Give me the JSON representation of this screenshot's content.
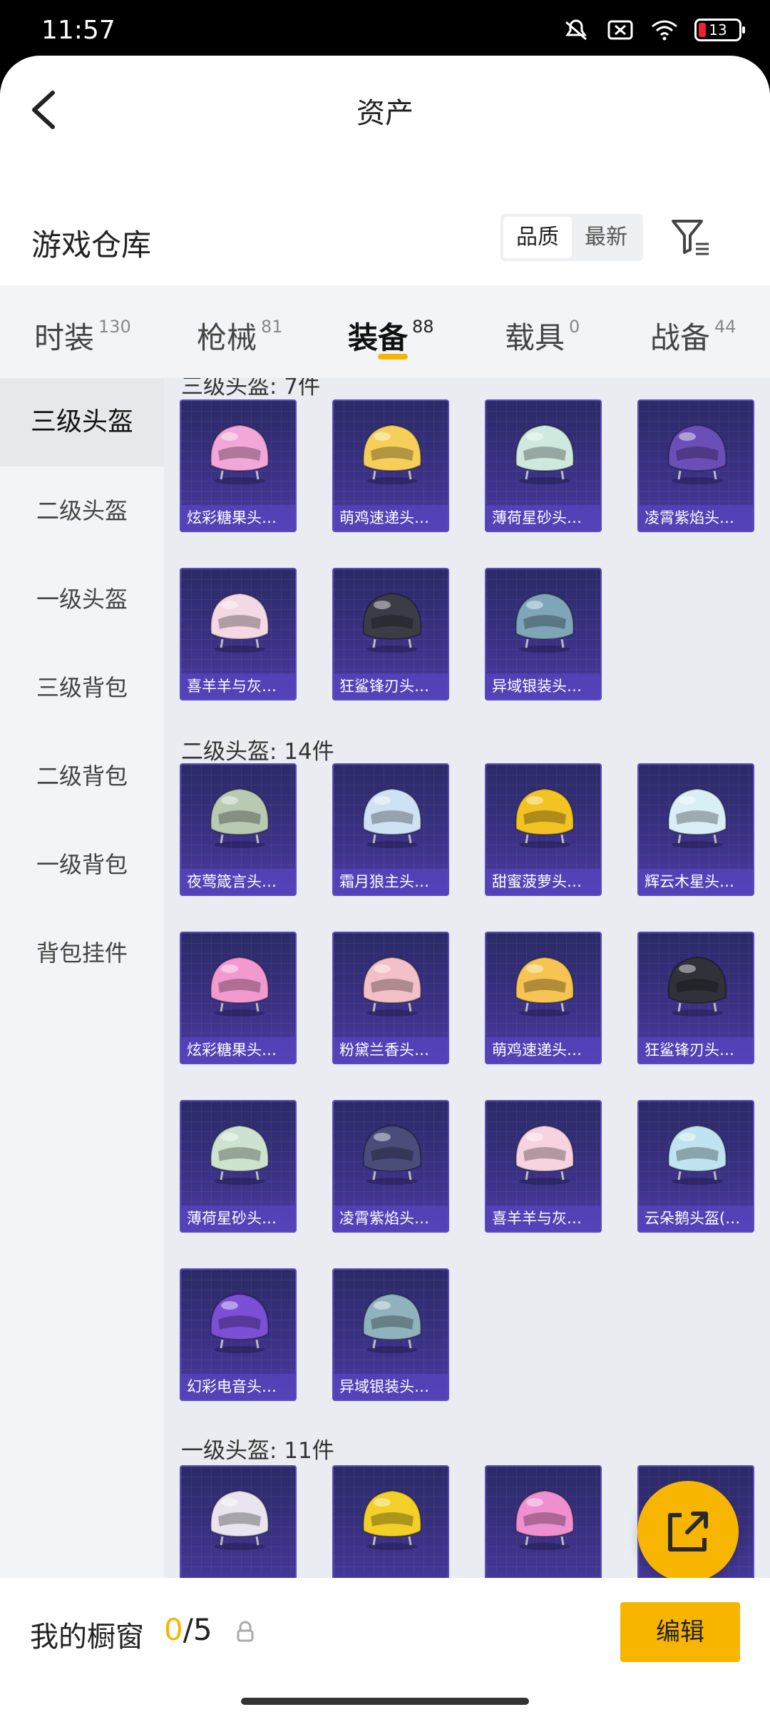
{
  "status_bar": {
    "time": "11:57",
    "battery": "13"
  },
  "header": {
    "title": "资产"
  },
  "warehouse": {
    "title": "游戏仓库",
    "sort_options": [
      "品质",
      "最新"
    ],
    "sort_selected": "品质"
  },
  "categories": [
    {
      "label": "时装",
      "count": "130"
    },
    {
      "label": "枪械",
      "count": "81"
    },
    {
      "label": "装备",
      "count": "88",
      "active": true
    },
    {
      "label": "载具",
      "count": "0"
    },
    {
      "label": "战备",
      "count": "44"
    }
  ],
  "sidebar": {
    "items": [
      "三级头盔",
      "二级头盔",
      "一级头盔",
      "三级背包",
      "二级背包",
      "一级背包",
      "背包挂件"
    ],
    "active": "三级头盔"
  },
  "sections": [
    {
      "title": "三级头盔: 7件",
      "items": [
        "炫彩糖果头…",
        "萌鸡速递头…",
        "薄荷星砂头…",
        "凌霄紫焰头…",
        "喜羊羊与灰…",
        "狂鲨锋刃头…",
        "异域银装头…"
      ]
    },
    {
      "title": "二级头盔: 14件",
      "items": [
        "夜莺箴言头…",
        "霜月狼主头…",
        "甜蜜菠萝头…",
        "辉云木星头…",
        "炫彩糖果头…",
        "粉黛兰香头…",
        "萌鸡速递头…",
        "狂鲨锋刃头…",
        "薄荷星砂头…",
        "凌霄紫焰头…",
        "喜羊羊与灰…",
        "云朵鹅头盔(…",
        "幻彩电音头…",
        "异域银装头…"
      ]
    },
    {
      "title": "一级头盔: 11件",
      "items": [
        "",
        "",
        "",
        ""
      ]
    }
  ],
  "colors": {
    "accent": "#f7b500",
    "card_bg": "#3a3184"
  },
  "bottom": {
    "title": "我的橱窗",
    "current": "0",
    "total": "/5",
    "edit_label": "编辑"
  }
}
